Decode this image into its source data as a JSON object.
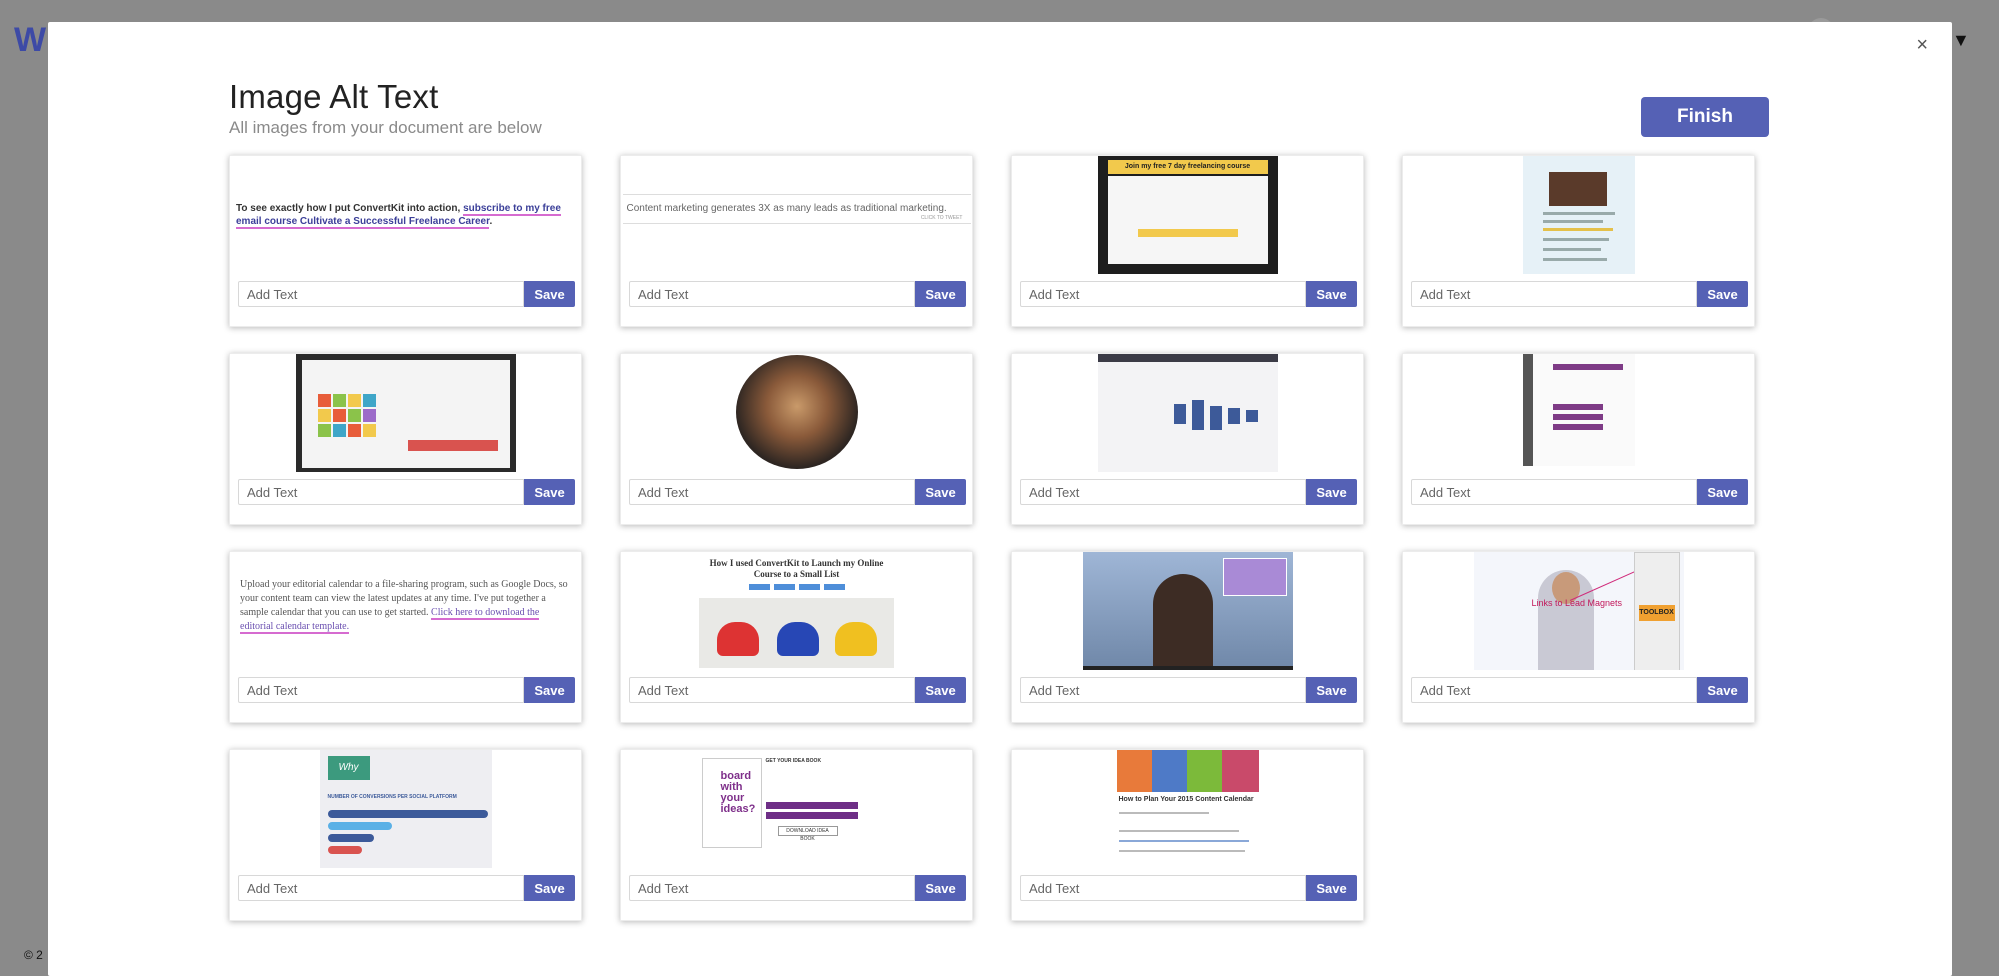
{
  "background": {
    "logo_letter": "W",
    "menu_caret": "▼",
    "footer_text": "© 2"
  },
  "modal": {
    "close_label": "×",
    "title": "Image Alt Text",
    "subtitle": "All images from your document are below",
    "finish_label": "Finish"
  },
  "card_defaults": {
    "input_placeholder": "Add Text",
    "save_label": "Save"
  },
  "thumbnails": {
    "t1": {
      "text": "To see exactly how I put ConvertKit into action, ",
      "link": "subscribe to my free email course Cultivate a Successful Freelance Career",
      "end": "."
    },
    "t2": {
      "quote": "Content marketing generates 3X as many leads as traditional marketing.",
      "cta": "CLICK TO TWEET"
    },
    "t3": {
      "banner": "Join my free 7 day freelancing course"
    },
    "t9": {
      "text": "Upload your editorial calendar to a file-sharing program, such as Google Docs, so your content team can view the latest updates at any time. I've put together a sample calendar that you can use to get started. ",
      "link": "Click here to download the editorial calendar template."
    },
    "t10": {
      "headline": "How I used ConvertKit to Launch my Online Course to a Small List"
    },
    "t12": {
      "label": "Links to Lead Magnets",
      "book": "TOOLBOX"
    },
    "t13": {
      "tag": "Why",
      "heading": "NUMBER OF CONVERSIONS PER SOCIAL PLATFORM"
    },
    "t14": {
      "cover": "board with your ideas?",
      "heading": "GET YOUR IDEA BOOK",
      "button": "DOWNLOAD IDEA BOOK"
    },
    "t15": {
      "headline": "How to Plan Your 2015 Content Calendar"
    }
  },
  "colors": {
    "accent": "#5561b5",
    "link_underline": "#d66bd0",
    "backdrop": "#8a8a8a"
  }
}
